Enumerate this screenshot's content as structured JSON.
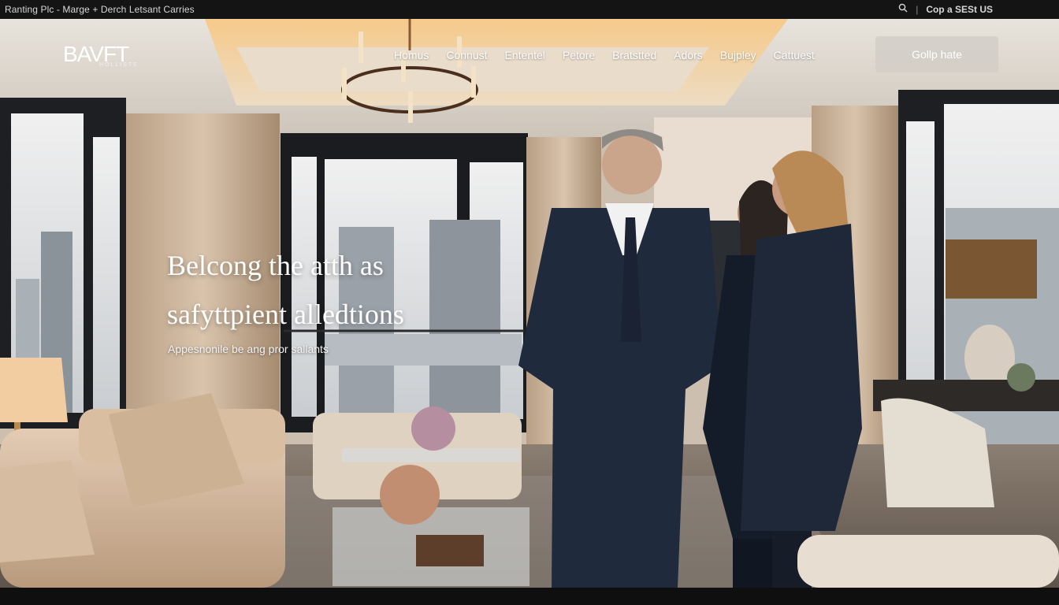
{
  "topbar": {
    "breadcrumb": "Ranting Plc - Marge + Derch Letsant Carries",
    "search_icon": "search-icon",
    "cta_label": "Cop a SESt US"
  },
  "header": {
    "logo_text": "BAVFT",
    "logo_sub": "HOLLISTE",
    "nav": [
      {
        "label": "Homus"
      },
      {
        "label": "Connust"
      },
      {
        "label": "Ententel"
      },
      {
        "label": "Petore"
      },
      {
        "label": "Bratstted"
      },
      {
        "label": "Adors"
      },
      {
        "label": "Bujpley"
      },
      {
        "label": "Cattuest"
      }
    ],
    "cta_button": "Gollp hate"
  },
  "hero": {
    "headline_line1": "Belcong the atth as",
    "headline_line2": "safyttpient alledtions",
    "subheadline": "Appesnonile be ang pror sallants"
  },
  "colors": {
    "topbar_bg": "#141414",
    "cta_button_bg": "#d4cec8",
    "text_on_hero": "#ffffff"
  }
}
